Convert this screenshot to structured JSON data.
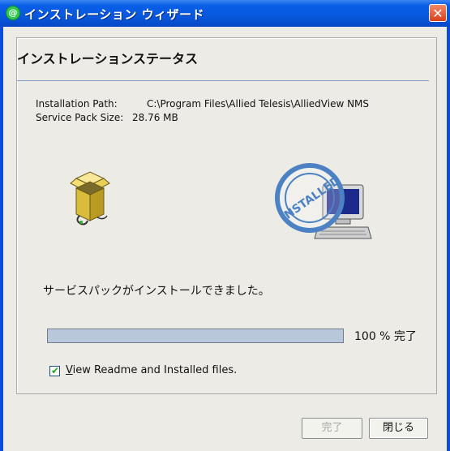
{
  "window": {
    "title": "インストレーション ウィザード",
    "close_glyph": "✕"
  },
  "page": {
    "heading": "インストレーションステータス",
    "install_path_label": "Installation Path:",
    "install_path_value": "C:\\Program Files\\Allied Telesis\\AlliedView NMS",
    "sp_size_label": "Service Pack Size:",
    "sp_size_value": "28.76 MB",
    "installed_stamp_text": "INSTALLED",
    "status_message": "サービスパックがインストールできました。",
    "progress": {
      "percent": 100,
      "label": "100 % 完了"
    },
    "checkbox": {
      "checked": true,
      "label_underlined": "V",
      "label_rest": "iew Readme and Installed files."
    }
  },
  "buttons": {
    "finish": "完了",
    "close": "閉じる"
  },
  "colors": {
    "titlebar": "#0758de",
    "window_bg": "#ecebe6",
    "separator": "#7d9fc6",
    "progress": "#b8c7da"
  }
}
